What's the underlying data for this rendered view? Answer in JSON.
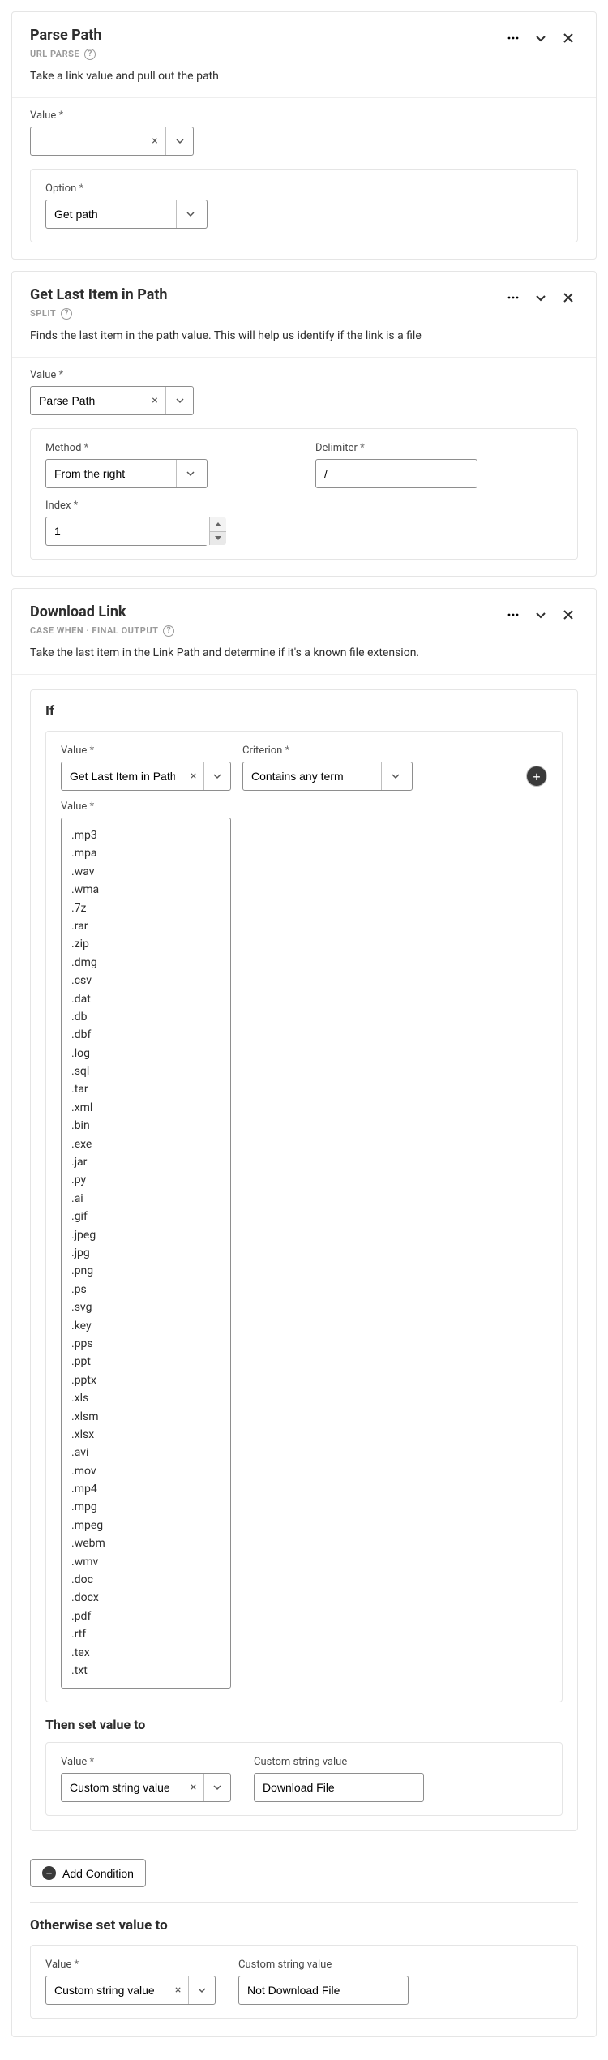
{
  "panel1": {
    "title": "Parse Path",
    "subtitle": "URL PARSE",
    "description": "Take a link value and pull out the path",
    "value_label": "Value",
    "value_input": "",
    "option_label": "Option",
    "option_value": "Get path"
  },
  "panel2": {
    "title": "Get Last Item in Path",
    "subtitle": "SPLIT",
    "description": "Finds the last item in the path value. This will help us identify if the link is a file",
    "value_label": "Value",
    "value_input": "Parse Path",
    "method_label": "Method",
    "method_value": "From the right",
    "delimiter_label": "Delimiter",
    "delimiter_value": "/",
    "index_label": "Index",
    "index_value": "1"
  },
  "panel3": {
    "title": "Download Link",
    "subtitle": "CASE WHEN · FINAL OUTPUT",
    "description": "Take the last item in the Link Path and determine if it's a known file extension.",
    "if_label": "If",
    "if_value_label": "Value",
    "if_value_input": "Get Last Item in Path",
    "criterion_label": "Criterion",
    "criterion_value": "Contains any term",
    "list_label": "Value",
    "list": [
      ".mp3",
      ".mpa",
      ".wav",
      ".wma",
      ".7z",
      ".rar",
      ".zip",
      ".dmg",
      ".csv",
      ".dat",
      ".db",
      ".dbf",
      ".log",
      ".sql",
      ".tar",
      ".xml",
      ".bin",
      ".exe",
      ".jar",
      ".py",
      ".ai",
      ".gif",
      ".jpeg",
      ".jpg",
      ".png",
      ".ps",
      ".svg",
      ".key",
      ".pps",
      ".ppt",
      ".pptx",
      ".xls",
      ".xlsm",
      ".xlsx",
      ".avi",
      ".mov",
      ".mp4",
      ".mpg",
      ".mpeg",
      ".webm",
      ".wmv",
      ".doc",
      ".docx",
      ".pdf",
      ".rtf",
      ".tex",
      ".txt"
    ],
    "then_label": "Then set value to",
    "then_value_label": "Value",
    "then_value_input": "Custom string value",
    "then_string_label": "Custom string value",
    "then_string_value": "Download File",
    "add_condition": "Add Condition",
    "otherwise_label": "Otherwise set value to",
    "otherwise_value_label": "Value",
    "otherwise_value_input": "Custom string value",
    "otherwise_string_label": "Custom string value",
    "otherwise_string_value": "Not Download File"
  }
}
